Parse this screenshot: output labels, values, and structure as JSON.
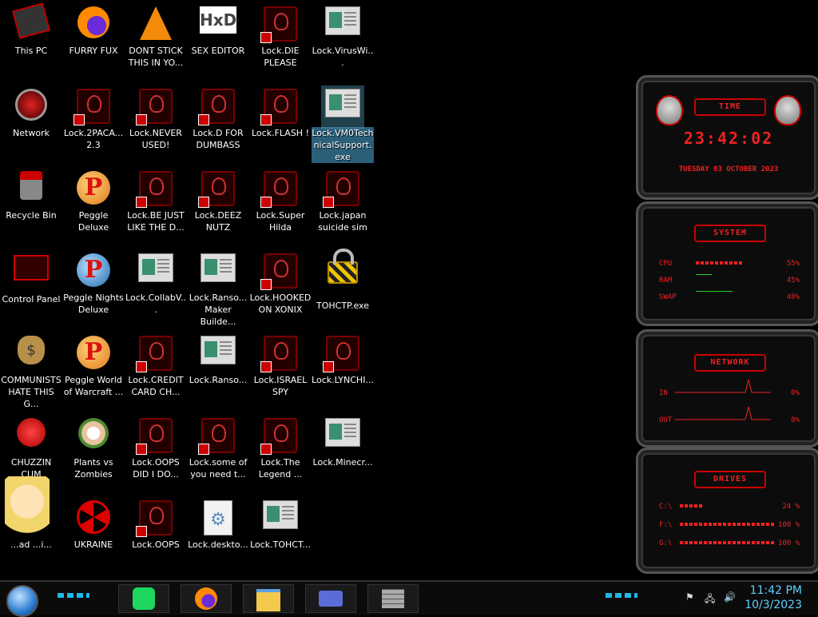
{
  "desktop": {
    "icons": [
      {
        "label": "This PC",
        "kind": "pc"
      },
      {
        "label": "FURRY FUX",
        "kind": "firefox"
      },
      {
        "label": "DONT STICK THIS IN YO...",
        "kind": "vlc"
      },
      {
        "label": "SEX EDITOR",
        "kind": "hxd"
      },
      {
        "label": "Lock.DIE PLEASE",
        "kind": "lock"
      },
      {
        "label": "Lock.VirusWi...",
        "kind": "window"
      },
      {
        "label": "Network",
        "kind": "network"
      },
      {
        "label": "Lock.2PACA... 2.3",
        "kind": "lock"
      },
      {
        "label": "Lock.NEVER USED!",
        "kind": "lock"
      },
      {
        "label": "Lock.D FOR DUMBASS",
        "kind": "lock"
      },
      {
        "label": "Lock.FLASH !",
        "kind": "lock"
      },
      {
        "label": "Lock.VM0TechnicalSupport.exe",
        "kind": "window"
      },
      {
        "label": "Recycle Bin",
        "kind": "recycle"
      },
      {
        "label": "Peggle Deluxe",
        "kind": "peggle"
      },
      {
        "label": "Lock.BE JUST LIKE THE D...",
        "kind": "lock"
      },
      {
        "label": "Lock.DEEZ NUTZ",
        "kind": "lock"
      },
      {
        "label": "Lock.Super Hilda",
        "kind": "lock"
      },
      {
        "label": "Lock.japan suicide sim",
        "kind": "lock"
      },
      {
        "label": "Control Panel",
        "kind": "control"
      },
      {
        "label": "Peggle Nights Deluxe",
        "kind": "peggle"
      },
      {
        "label": "Lock.CollabV...",
        "kind": "window"
      },
      {
        "label": "Lock.Ranso... Maker Builde...",
        "kind": "window"
      },
      {
        "label": "Lock.HOOKED ON XONIX",
        "kind": "lock"
      },
      {
        "label": "TOHCTP.exe",
        "kind": "padlock"
      },
      {
        "label": "COMMUNISTS HATE THIS G...",
        "kind": "moneybag"
      },
      {
        "label": "Peggle World of Warcraft ...",
        "kind": "peggle"
      },
      {
        "label": "Lock.CREDIT CARD CH...",
        "kind": "lock"
      },
      {
        "label": "Lock.Ranso...",
        "kind": "window"
      },
      {
        "label": "Lock.ISRAEL SPY",
        "kind": "lock"
      },
      {
        "label": "Lock.LYNCHI...",
        "kind": "lock"
      },
      {
        "label": "CHUZZIN CUM",
        "kind": "chuzzle"
      },
      {
        "label": "Plants vs Zombies",
        "kind": "pvz"
      },
      {
        "label": "Lock.OOPS DID I DO...",
        "kind": "lock"
      },
      {
        "label": "Lock.some of you need t...",
        "kind": "lock"
      },
      {
        "label": "Lock.The Legend ...",
        "kind": "lock"
      },
      {
        "label": "Lock.Minecr...",
        "kind": "window"
      },
      {
        "label": "...ad ...i...",
        "kind": "cartoon"
      },
      {
        "label": "UKRAINE",
        "kind": "radiation"
      },
      {
        "label": "Lock.OOPS",
        "kind": "lock"
      },
      {
        "label": "Lock.deskto...",
        "kind": "file"
      },
      {
        "label": "Lock.TOHCT...",
        "kind": "window"
      }
    ],
    "selected_label": "Lock.VM0TechnicalSupport.exe"
  },
  "widgets": {
    "time": {
      "title": "TIME",
      "clock": "23:42:02",
      "date": "TUESDAY 03 OCTOBER 2023"
    },
    "system": {
      "title": "SYSTEM",
      "rows": [
        {
          "label": "CPU",
          "value": "55%",
          "level": 0.55
        },
        {
          "label": "RAM",
          "value": "45%",
          "level": 0.45
        },
        {
          "label": "SWAP",
          "value": "48%",
          "level": 0.48
        }
      ]
    },
    "network": {
      "title": "NETWORK",
      "rows": [
        {
          "label": "IN",
          "value": "0%"
        },
        {
          "label": "OUT",
          "value": "0%"
        }
      ]
    },
    "drives": {
      "title": "DRIVES",
      "rows": [
        {
          "label": "C:\\",
          "value": "24 %",
          "level": 0.24
        },
        {
          "label": "F:\\",
          "value": "100 %",
          "level": 1.0
        },
        {
          "label": "G:\\",
          "value": "100 %",
          "level": 1.0
        }
      ]
    }
  },
  "taskbar": {
    "pinned": [
      "spotify-app",
      "firefox-app",
      "file-explorer-app",
      "card-app",
      "wall-app"
    ],
    "clock_time": "11:42 PM",
    "clock_date": "10/3/2023",
    "tray_icons": [
      "network-error-icon",
      "network-icon",
      "volume-icon"
    ]
  },
  "colors": {
    "accent_red": "#e22222",
    "accent_cyan": "#1fb8e8",
    "clock_blue": "#5fd0ff"
  }
}
